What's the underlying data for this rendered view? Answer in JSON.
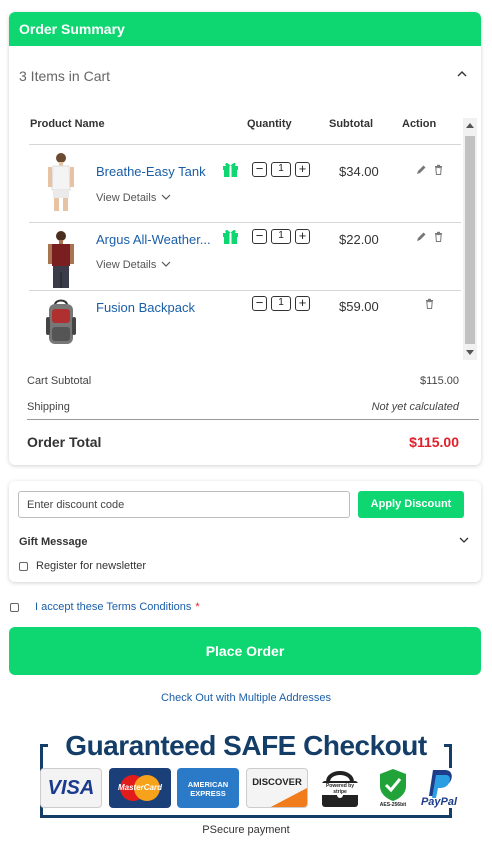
{
  "header": {
    "title": "Order Summary"
  },
  "cart": {
    "items_label": "3 Items in Cart",
    "columns": [
      "Product Name",
      "Quantity",
      "Subtotal",
      "Action"
    ],
    "items": [
      {
        "name": "Breathe-Easy Tank",
        "view_details": "View Details",
        "qty": "1",
        "subtotal": "$34.00"
      },
      {
        "name": "Argus All-Weather...",
        "view_details": "View Details",
        "qty": "1",
        "subtotal": "$22.00"
      },
      {
        "name": "Fusion Backpack",
        "qty": "1",
        "subtotal": "$59.00"
      }
    ]
  },
  "totals": {
    "cart_subtotal_label": "Cart Subtotal",
    "cart_subtotal_value": "$115.00",
    "shipping_label": "Shipping",
    "shipping_value": "Not yet calculated",
    "order_total_label": "Order Total",
    "order_total_value": "$115.00"
  },
  "discount": {
    "placeholder": "Enter discount code",
    "apply_label": "Apply Discount"
  },
  "gift": {
    "title": "Gift Message"
  },
  "newsletter": {
    "label": "Register for newsletter"
  },
  "terms": {
    "label": "I accept these Terms Conditions",
    "required": "*"
  },
  "actions": {
    "place_order": "Place Order",
    "multi_address": "Check Out with Multiple Addresses"
  },
  "badge": {
    "title": "Guaranteed SAFE Checkout",
    "payments": [
      "VISA",
      "MasterCard",
      "AMERICAN EXPRESS",
      "DISCOVER",
      "Powered by stripe",
      "AES-256bit",
      "PayPal"
    ]
  },
  "footer": {
    "caption": "PSecure payment"
  },
  "colors": {
    "accent": "#0ed772",
    "link": "#1a5ea8",
    "total": "#e0202a",
    "badge": "#143d68"
  }
}
